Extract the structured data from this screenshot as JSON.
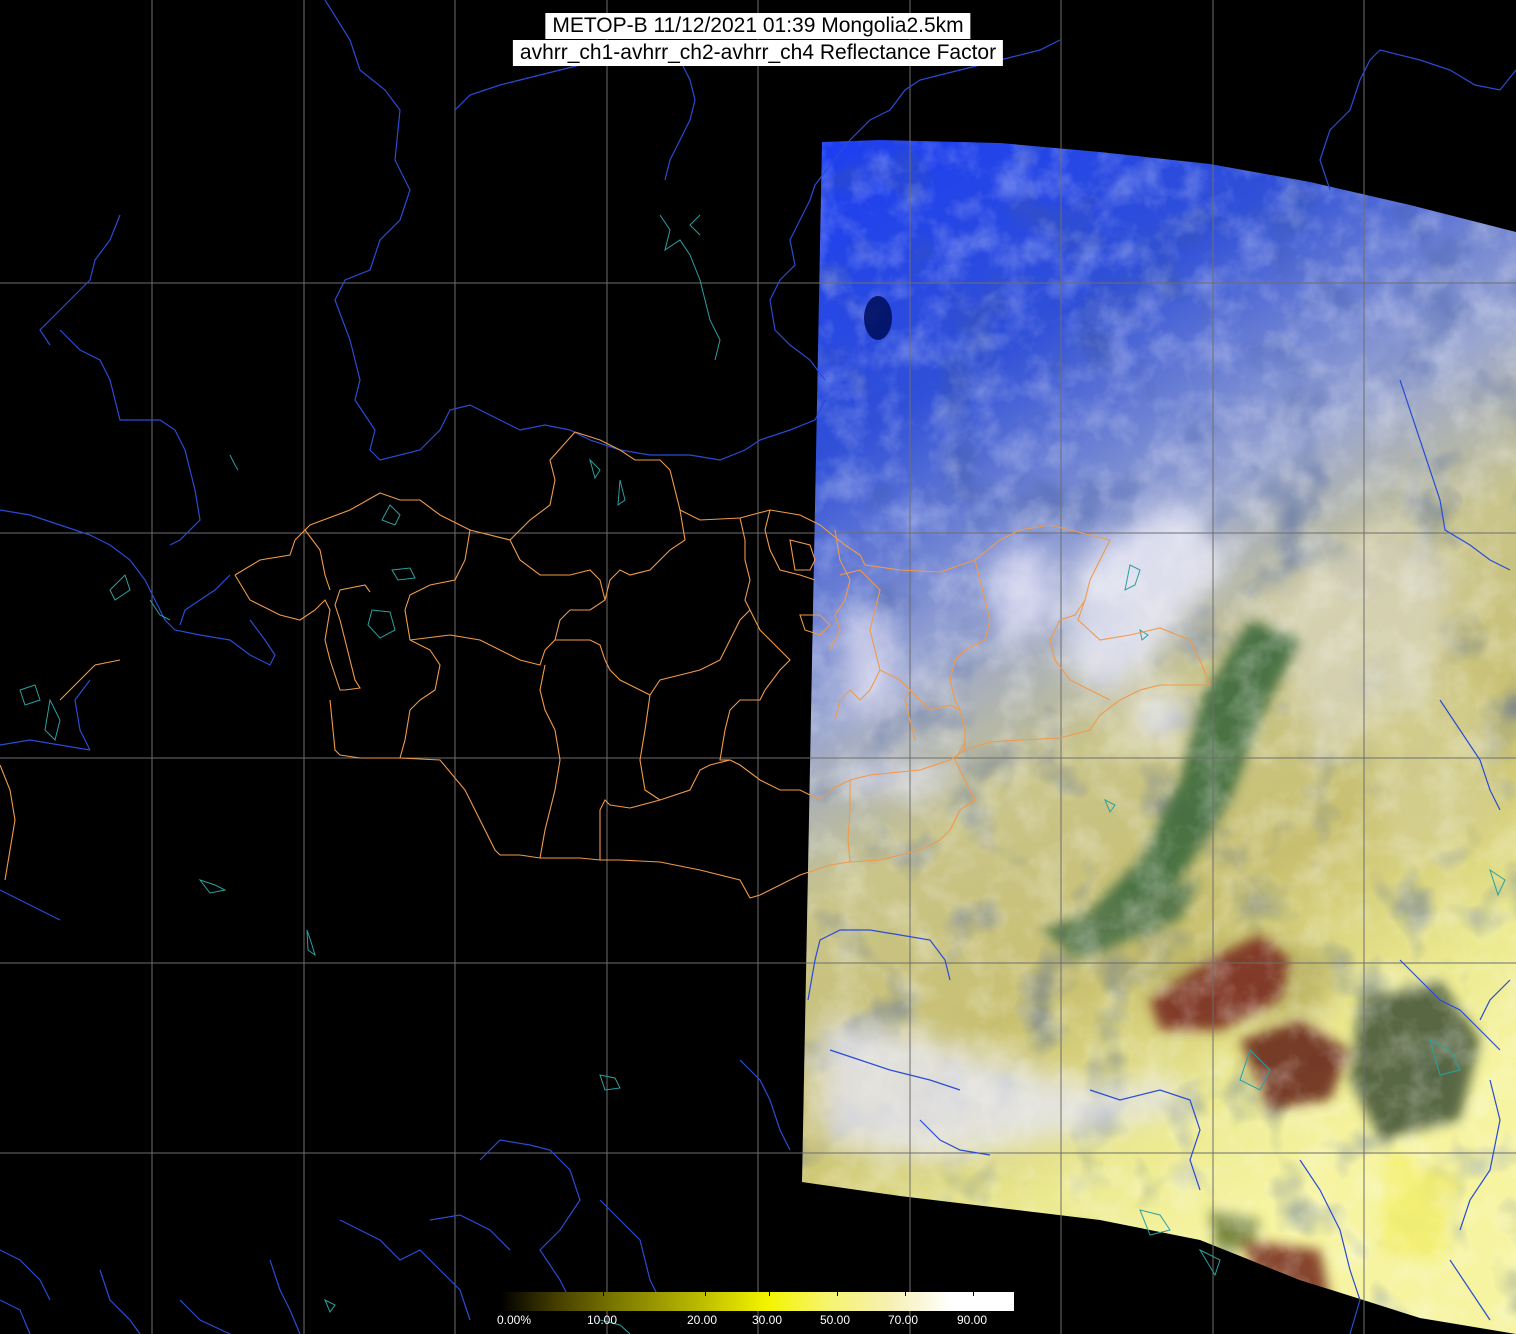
{
  "title": {
    "line1": "METOP-B 11/12/2021 01:39 Mongolia2.5km",
    "line2": "avhrr_ch1-avhrr_ch2-avhrr_ch4 Reflectance Factor"
  },
  "colorbar": {
    "labels": [
      "0.00%",
      "10.00",
      "20.00",
      "30.00",
      "50.00",
      "70.00",
      "90.00"
    ],
    "colors": [
      "#000000",
      "#7a7600",
      "#f4f400",
      "#f6f0b4",
      "#ffffff"
    ]
  },
  "colors": {
    "graticule": "#6e6e6e",
    "coastline_rivers": "#2a4bd6",
    "lakes": "#2aa0a0",
    "admin_boundaries": "#f09a4a",
    "clouds_north": "#1e3cff",
    "desert": "#c8c070"
  }
}
